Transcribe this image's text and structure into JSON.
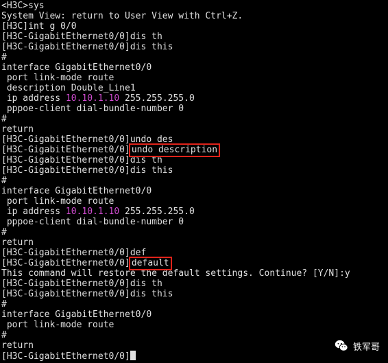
{
  "terminal": {
    "lines": [
      {
        "text": "<H3C>sys"
      },
      {
        "text": "System View: return to User View with Ctrl+Z."
      },
      {
        "text": "[H3C]int g 0/0"
      },
      {
        "text": "[H3C-GigabitEthernet0/0]dis th"
      },
      {
        "text": "[H3C-GigabitEthernet0/0]dis this"
      },
      {
        "text": "#"
      },
      {
        "text": "interface GigabitEthernet0/0"
      },
      {
        "text": " port link-mode route"
      },
      {
        "text": " description Double_Line1"
      },
      {
        "pre": " ip address ",
        "ip": "10.10.1.10",
        "post": " 255.255.255.0"
      },
      {
        "text": " pppoe-client dial-bundle-number 0"
      },
      {
        "text": "#"
      },
      {
        "text": "return"
      },
      {
        "text": "[H3C-GigabitEthernet0/0]undo des"
      },
      {
        "prompt": "[H3C-GigabitEthernet0/0]",
        "highlight": "undo description"
      },
      {
        "text": "[H3C-GigabitEthernet0/0]dis th"
      },
      {
        "text": "[H3C-GigabitEthernet0/0]dis this"
      },
      {
        "text": "#"
      },
      {
        "text": "interface GigabitEthernet0/0"
      },
      {
        "text": " port link-mode route"
      },
      {
        "pre": " ip address ",
        "ip": "10.10.1.10",
        "post": " 255.255.255.0"
      },
      {
        "text": " pppoe-client dial-bundle-number 0"
      },
      {
        "text": "#"
      },
      {
        "text": "return"
      },
      {
        "text": "[H3C-GigabitEthernet0/0]def"
      },
      {
        "prompt": "[H3C-GigabitEthernet0/0]",
        "highlight": "default"
      },
      {
        "text": "This command will restore the default settings. Continue? [Y/N]:y"
      },
      {
        "text": "[H3C-GigabitEthernet0/0]dis th"
      },
      {
        "text": "[H3C-GigabitEthernet0/0]dis this"
      },
      {
        "text": "#"
      },
      {
        "text": "interface GigabitEthernet0/0"
      },
      {
        "text": " port link-mode route"
      },
      {
        "text": "#"
      },
      {
        "text": "return"
      },
      {
        "prompt": "[H3C-GigabitEthernet0/0]",
        "cursor": true
      }
    ]
  },
  "watermark": {
    "text": "铁军哥",
    "icon": "wechat-icon"
  },
  "colors": {
    "background": "#000000",
    "text": "#e0e0e0",
    "ip_address": "#d04cd0",
    "highlight_box": "#e0231a"
  }
}
